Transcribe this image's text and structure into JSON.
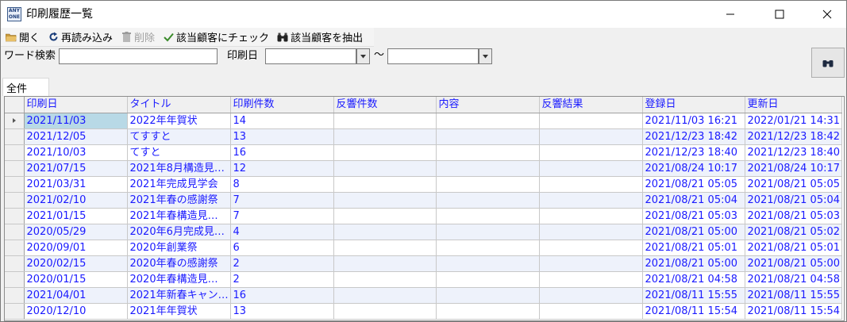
{
  "window": {
    "title": "印刷履歴一覧",
    "icon_text": "ANY ONE"
  },
  "toolbar": {
    "open_label": "開く",
    "reload_label": "再読み込み",
    "delete_label": "削除",
    "check_label": "該当顧客にチェック",
    "extract_label": "該当顧客を抽出"
  },
  "search": {
    "keyword_label": "ワード検索",
    "keyword_value": "",
    "date_label": "印刷日",
    "date_from": "",
    "range_sep": "～",
    "date_to": ""
  },
  "tabs": [
    "全件"
  ],
  "grid": {
    "columns": [
      "印刷日",
      "タイトル",
      "印刷件数",
      "反響件数",
      "内容",
      "反響結果",
      "登録日",
      "更新日"
    ],
    "rows": [
      [
        "2021/11/03",
        "2022年年賀状",
        "14",
        "",
        "",
        "",
        "2021/11/03 16:21",
        "2022/01/21 14:31"
      ],
      [
        "2021/12/05",
        "てすすと",
        "13",
        "",
        "",
        "",
        "2021/12/23 18:42",
        "2021/12/23 18:42"
      ],
      [
        "2021/10/03",
        "てすと",
        "16",
        "",
        "",
        "",
        "2021/12/23 18:40",
        "2021/12/23 18:40"
      ],
      [
        "2021/07/15",
        "2021年8月構造見…",
        "12",
        "",
        "",
        "",
        "2021/08/24 10:17",
        "2021/08/24 10:17"
      ],
      [
        "2021/03/31",
        "2021年完成見学会",
        "8",
        "",
        "",
        "",
        "2021/08/21 05:05",
        "2021/08/21 05:05"
      ],
      [
        "2021/02/10",
        "2021年春の感謝祭",
        "7",
        "",
        "",
        "",
        "2021/08/21 05:04",
        "2021/08/21 05:04"
      ],
      [
        "2021/01/15",
        "2021年春構造見…",
        "7",
        "",
        "",
        "",
        "2021/08/21 05:03",
        "2021/08/21 05:03"
      ],
      [
        "2020/05/29",
        "2020年6月完成見…",
        "4",
        "",
        "",
        "",
        "2021/08/21 05:00",
        "2021/08/21 05:02"
      ],
      [
        "2020/09/01",
        "2020年創業祭",
        "6",
        "",
        "",
        "",
        "2021/08/21 05:01",
        "2021/08/21 05:01"
      ],
      [
        "2020/02/15",
        "2020年春の感謝祭",
        "2",
        "",
        "",
        "",
        "2021/08/21 05:00",
        "2021/08/21 05:00"
      ],
      [
        "2020/01/15",
        "2020年春構造見…",
        "2",
        "",
        "",
        "",
        "2021/08/21 04:58",
        "2021/08/21 04:58"
      ],
      [
        "2021/04/01",
        "2021年新春キャン…",
        "16",
        "",
        "",
        "",
        "2021/08/11 15:55",
        "2021/08/11 15:55"
      ],
      [
        "2020/12/10",
        "2021年年賀状",
        "13",
        "",
        "",
        "",
        "2021/08/11 15:54",
        "2021/08/11 15:54"
      ]
    ]
  },
  "colors": {
    "grid_text": "#1a1aff",
    "selected_cell": "#b8d9e6",
    "alt_row": "#eef2fb"
  }
}
